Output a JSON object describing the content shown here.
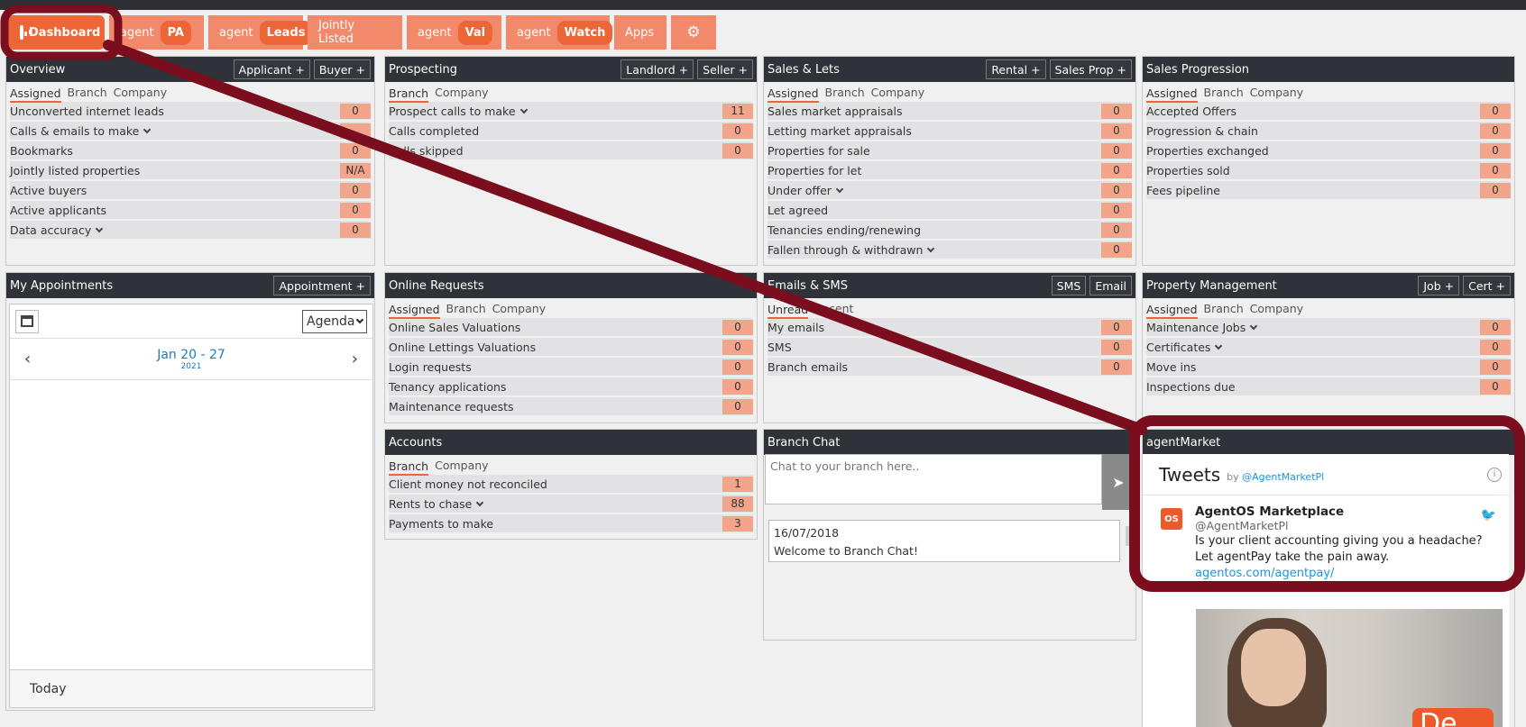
{
  "tabs": [
    {
      "label": "Dashboard",
      "active": true
    },
    {
      "prefix": "agent",
      "pill": "PA"
    },
    {
      "prefix": "agent",
      "pill": "Leads"
    },
    {
      "label": "Jointly Listed"
    },
    {
      "prefix": "agent",
      "pill": "Val"
    },
    {
      "prefix": "agent",
      "pill": "Watch"
    },
    {
      "label": "Apps"
    }
  ],
  "overview": {
    "title": "Overview",
    "buttons": [
      "Applicant +",
      "Buyer +"
    ],
    "filters": [
      "Assigned",
      "Branch",
      "Company"
    ],
    "rows": [
      {
        "label": "Unconverted internet leads",
        "value": "0"
      },
      {
        "label": "Calls & emails to make",
        "value": ""
      },
      {
        "label": "Bookmarks",
        "value": "0"
      },
      {
        "label": "Jointly listed properties",
        "value": "N/A"
      },
      {
        "label": "Active buyers",
        "value": "0"
      },
      {
        "label": "Active applicants",
        "value": "0"
      },
      {
        "label": "Data accuracy",
        "value": "0"
      }
    ]
  },
  "prospecting": {
    "title": "Prospecting",
    "buttons": [
      "Landlord +",
      "Seller +"
    ],
    "filters": [
      "Branch",
      "Company"
    ],
    "rows": [
      {
        "label": "Prospect calls to make",
        "value": "11"
      },
      {
        "label": "Calls completed",
        "value": "0"
      },
      {
        "label": "Calls skipped",
        "value": "0"
      }
    ]
  },
  "sales_lets": {
    "title": "Sales & Lets",
    "buttons": [
      "Rental +",
      "Sales Prop +"
    ],
    "filters": [
      "Assigned",
      "Branch",
      "Company"
    ],
    "rows": [
      {
        "label": "Sales market appraisals",
        "value": "0"
      },
      {
        "label": "Letting market appraisals",
        "value": "0"
      },
      {
        "label": "Properties for sale",
        "value": "0"
      },
      {
        "label": "Properties for let",
        "value": "0"
      },
      {
        "label": "Under offer",
        "value": "0"
      },
      {
        "label": "Let agreed",
        "value": "0"
      },
      {
        "label": "Tenancies ending/renewing",
        "value": "0"
      },
      {
        "label": "Fallen through & withdrawn",
        "value": "0"
      }
    ]
  },
  "sales_progression": {
    "title": "Sales Progression",
    "filters": [
      "Assigned",
      "Branch",
      "Company"
    ],
    "rows": [
      {
        "label": "Accepted Offers",
        "value": "0"
      },
      {
        "label": "Progression & chain",
        "value": "0"
      },
      {
        "label": "Properties exchanged",
        "value": "0"
      },
      {
        "label": "Properties sold",
        "value": "0"
      },
      {
        "label": "Fees pipeline",
        "value": "0"
      }
    ]
  },
  "appointments": {
    "title": "My Appointments",
    "button": "Appointment +",
    "view": "Agenda",
    "range": "Jan 20 - 27",
    "year": "2021",
    "today": "Today"
  },
  "online_requests": {
    "title": "Online Requests",
    "filters": [
      "Assigned",
      "Branch",
      "Company"
    ],
    "rows": [
      {
        "label": "Online Sales Valuations",
        "value": "0"
      },
      {
        "label": "Online Lettings Valuations",
        "value": "0"
      },
      {
        "label": "Login requests",
        "value": "0"
      },
      {
        "label": "Tenancy applications",
        "value": "0"
      },
      {
        "label": "Maintenance requests",
        "value": "0"
      }
    ]
  },
  "emails_sms": {
    "title": "Emails & SMS",
    "buttons": [
      "SMS",
      "Email"
    ],
    "filters": [
      "Unread",
      "Recent"
    ],
    "rows": [
      {
        "label": "My emails",
        "value": "0"
      },
      {
        "label": "SMS",
        "value": "0"
      },
      {
        "label": "Branch emails",
        "value": "0"
      }
    ]
  },
  "property_management": {
    "title": "Property Management",
    "buttons": [
      "Job +",
      "Cert +"
    ],
    "filters": [
      "Assigned",
      "Branch",
      "Company"
    ],
    "rows": [
      {
        "label": "Maintenance Jobs",
        "value": "0"
      },
      {
        "label": "Certificates",
        "value": "0"
      },
      {
        "label": "Move ins",
        "value": "0"
      },
      {
        "label": "Inspections due",
        "value": "0"
      }
    ]
  },
  "accounts": {
    "title": "Accounts",
    "filters": [
      "Branch",
      "Company"
    ],
    "rows": [
      {
        "label": "Client money not reconciled",
        "value": "1"
      },
      {
        "label": "Rents to chase",
        "value": "88"
      },
      {
        "label": "Payments to make",
        "value": "3"
      }
    ]
  },
  "branch_chat": {
    "title": "Branch Chat",
    "placeholder": "Chat to your branch here..",
    "message_date": "16/07/2018",
    "message_text": "Welcome to Branch Chat!"
  },
  "agent_market": {
    "title": "agentMarket",
    "tweets_label": "Tweets",
    "by": "by",
    "handle_link": "@AgentMarketPl",
    "tweet_name": "AgentOS Marketplace",
    "tweet_handle": "@AgentMarketPl",
    "tweet_logo": "OS",
    "tweet_text": "Is your client accounting giving you a headache? Let agentPay take the pain away.",
    "tweet_link": "agentos.com/agentpay/",
    "image_badge": "De"
  },
  "colors": {
    "accent": "#ec6637",
    "header": "#2f3238",
    "annotation": "#7a0d1e"
  }
}
